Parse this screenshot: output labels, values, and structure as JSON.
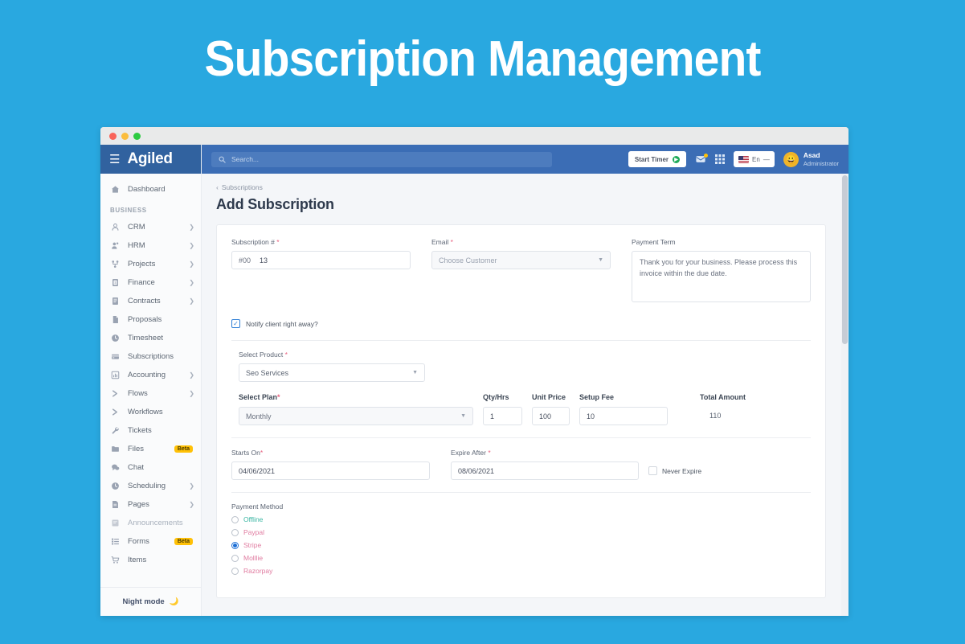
{
  "page_title": "Subscription Management",
  "window": {
    "dots": [
      "close",
      "minimize",
      "maximize"
    ]
  },
  "sidebar": {
    "brand": "Agiled",
    "section_label": "BUSINESS",
    "night_mode": "Night mode",
    "items": [
      {
        "label": "Dashboard",
        "icon": "home-icon",
        "chevron": false,
        "badge": "",
        "muted": false
      },
      {
        "label": "CRM",
        "icon": "user-icon",
        "chevron": true,
        "badge": "",
        "muted": false
      },
      {
        "label": "HRM",
        "icon": "users-icon",
        "chevron": true,
        "badge": "",
        "muted": false
      },
      {
        "label": "Projects",
        "icon": "project-icon",
        "chevron": true,
        "badge": "",
        "muted": false
      },
      {
        "label": "Finance",
        "icon": "finance-icon",
        "chevron": true,
        "badge": "",
        "muted": false
      },
      {
        "label": "Contracts",
        "icon": "contract-icon",
        "chevron": true,
        "badge": "",
        "muted": false
      },
      {
        "label": "Proposals",
        "icon": "document-icon",
        "chevron": false,
        "badge": "",
        "muted": false
      },
      {
        "label": "Timesheet",
        "icon": "clock-icon",
        "chevron": false,
        "badge": "",
        "muted": false
      },
      {
        "label": "Subscriptions",
        "icon": "card-icon",
        "chevron": false,
        "badge": "",
        "muted": false
      },
      {
        "label": "Accounting",
        "icon": "chart-icon",
        "chevron": true,
        "badge": "",
        "muted": false
      },
      {
        "label": "Flows",
        "icon": "flow-icon",
        "chevron": true,
        "badge": "",
        "muted": false
      },
      {
        "label": "Workflows",
        "icon": "workflow-icon",
        "chevron": false,
        "badge": "",
        "muted": false
      },
      {
        "label": "Tickets",
        "icon": "wrench-icon",
        "chevron": false,
        "badge": "",
        "muted": false
      },
      {
        "label": "Files",
        "icon": "folder-icon",
        "chevron": false,
        "badge": "Beta",
        "muted": false
      },
      {
        "label": "Chat",
        "icon": "chat-icon",
        "chevron": false,
        "badge": "",
        "muted": false
      },
      {
        "label": "Scheduling",
        "icon": "clock-icon",
        "chevron": true,
        "badge": "",
        "muted": false
      },
      {
        "label": "Pages",
        "icon": "pages-icon",
        "chevron": true,
        "badge": "",
        "muted": false
      },
      {
        "label": "Announcements",
        "icon": "announce-icon",
        "chevron": false,
        "badge": "",
        "muted": true
      },
      {
        "label": "Forms",
        "icon": "forms-icon",
        "chevron": false,
        "badge": "Beta",
        "muted": false
      },
      {
        "label": "Items",
        "icon": "cart-icon",
        "chevron": false,
        "badge": "",
        "muted": false
      }
    ]
  },
  "topbar": {
    "search_placeholder": "Search...",
    "start_timer": "Start Timer",
    "language": "En",
    "language_caret": "—",
    "user_name": "Asad",
    "user_role": "Administrator"
  },
  "main": {
    "breadcrumb": "Subscriptions",
    "heading": "Add Subscription",
    "subscription_number": {
      "label": "Subscription #",
      "required": "*",
      "prefix": "#00",
      "value": "13"
    },
    "email": {
      "label": "Email",
      "required": "*",
      "placeholder": "Choose Customer"
    },
    "payment_term": {
      "label": "Payment Term",
      "value": "Thank you for your business. Please process this invoice within the due date."
    },
    "notify": {
      "label": "Notify client right away?",
      "checked": true
    },
    "select_product": {
      "label": "Select Product",
      "required": "*",
      "value": "Seo Services"
    },
    "select_plan": {
      "label": "Select Plan",
      "required": "*",
      "value": "Monthly"
    },
    "qty": {
      "label": "Qty/Hrs",
      "value": "1"
    },
    "unit_price": {
      "label": "Unit Price",
      "value": "100"
    },
    "setup_fee": {
      "label": "Setup Fee",
      "value": "10"
    },
    "total_amount": {
      "label": "Total Amount",
      "value": "110"
    },
    "starts_on": {
      "label": "Starts On",
      "required": "*",
      "value": "04/06/2021"
    },
    "expire_after": {
      "label": "Expire After",
      "required": "*",
      "value": "08/06/2021"
    },
    "never_expire": {
      "label": "Never Expire",
      "checked": false
    },
    "payment_method": {
      "label": "Payment Method",
      "options": [
        {
          "label": "Offline",
          "color": "#3bb6a3",
          "selected": false
        },
        {
          "label": "Paypal",
          "color": "#e07ba0",
          "selected": false
        },
        {
          "label": "Stripe",
          "color": "#e07ba0",
          "selected": true
        },
        {
          "label": "Molllie",
          "color": "#e07ba0",
          "selected": false
        },
        {
          "label": "Razorpay",
          "color": "#e07ba0",
          "selected": false
        }
      ]
    }
  },
  "colors": {
    "page_bg": "#29a8e0",
    "navbar": "#3b6db5",
    "brand_bar": "#31629f",
    "accent_required": "#e8617f",
    "selected_radio": "#1d6fd6"
  }
}
